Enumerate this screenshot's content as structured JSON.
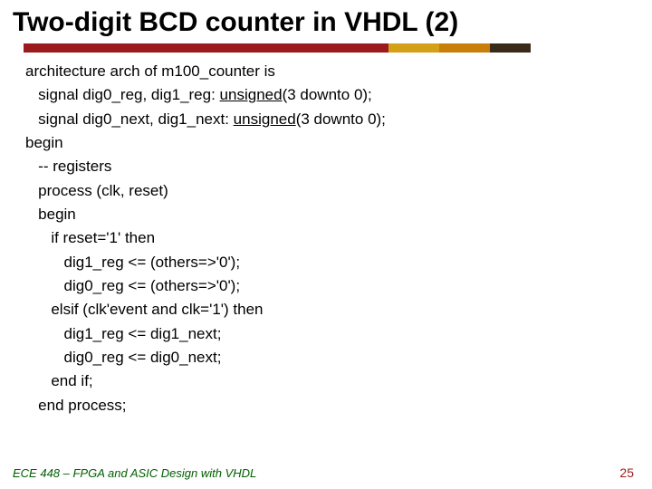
{
  "title": "Two-digit BCD counter in VHDL (2)",
  "code": {
    "line01": "architecture arch of m100_counter is",
    "line02_a": "   signal dig0_reg, dig1_reg: ",
    "line02_b": "unsigned",
    "line02_c": "(3 downto 0);",
    "line03_a": "   signal dig0_next, dig1_next: ",
    "line03_b": "unsigned",
    "line03_c": "(3 downto 0);",
    "line04": "begin",
    "line05": "   -- registers",
    "line06": "   process (clk, reset)",
    "line07": "   begin",
    "line08": "      if reset='1' then",
    "line09": "         dig1_reg <= (others=>'0');",
    "line10": "         dig0_reg <= (others=>'0');",
    "line11": "      elsif (clk'event and clk='1') then",
    "line12": "         dig1_reg <= dig1_next;",
    "line13": "         dig0_reg <= dig0_next;",
    "line14": "      end if;",
    "line15": "   end process;"
  },
  "footer": {
    "left": "ECE 448 – FPGA and ASIC Design with VHDL",
    "right": "25"
  }
}
